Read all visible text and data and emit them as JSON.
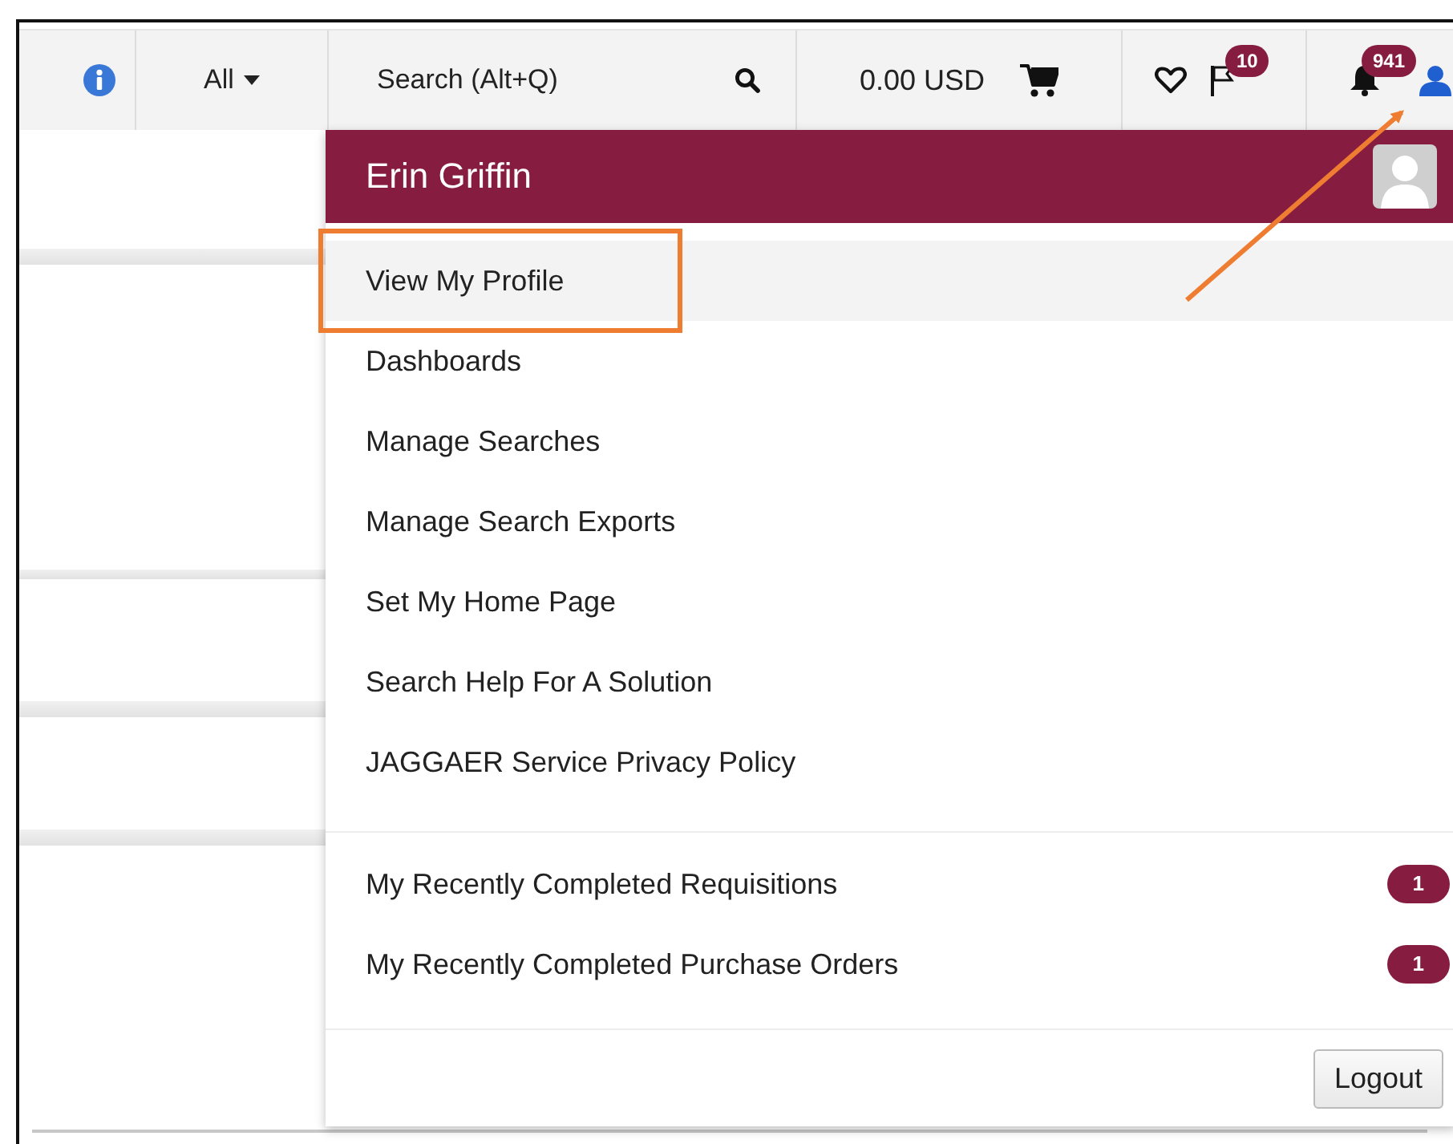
{
  "toolbar": {
    "scope": "All",
    "search": {
      "placeholder": "Search (Alt+Q)"
    },
    "cart_total": "0.00 USD",
    "flag_count": "10",
    "notification_count": "941"
  },
  "user_menu": {
    "user_name": "Erin Griffin",
    "items": [
      {
        "label": "View My Profile",
        "selected": true
      },
      {
        "label": "Dashboards",
        "selected": false
      },
      {
        "label": "Manage Searches",
        "selected": false
      },
      {
        "label": "Manage Search Exports",
        "selected": false
      },
      {
        "label": "Set My Home Page",
        "selected": false
      },
      {
        "label": "Search Help For A Solution",
        "selected": false
      },
      {
        "label": "JAGGAER Service Privacy Policy",
        "selected": false
      }
    ],
    "recent": [
      {
        "label": "My Recently Completed Requisitions",
        "count": "1"
      },
      {
        "label": "My Recently Completed Purchase Orders",
        "count": "1"
      }
    ],
    "logout": "Logout"
  }
}
